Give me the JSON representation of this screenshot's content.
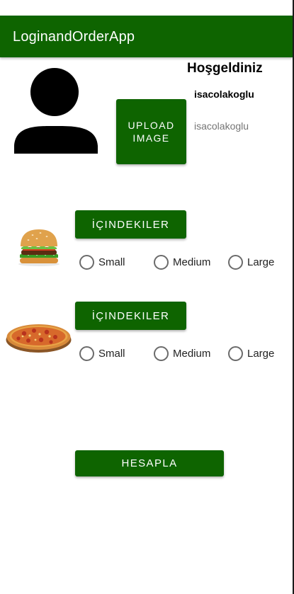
{
  "app": {
    "title": "LoginandOrderApp"
  },
  "colors": {
    "primary": "#0e6400",
    "button_text": "#ffffff",
    "secondary_text": "#757575",
    "radio_border": "#6b6b6b"
  },
  "profile": {
    "avatar_icon": "person-icon",
    "upload_button": "UPLOAD\nIMAGE",
    "welcome": "Hoşgeldiniz",
    "username": "isacolakoglu",
    "username_secondary": "isacolakoglu"
  },
  "products": [
    {
      "image_icon": "hamburger-image",
      "ingredients_button": "İÇINDEKILER",
      "sizes": [
        "Small",
        "Medium",
        "Large"
      ]
    },
    {
      "image_icon": "pizza-image",
      "ingredients_button": "İÇINDEKILER",
      "sizes": [
        "Small",
        "Medium",
        "Large"
      ]
    }
  ],
  "calculate_button": "HESAPLA"
}
